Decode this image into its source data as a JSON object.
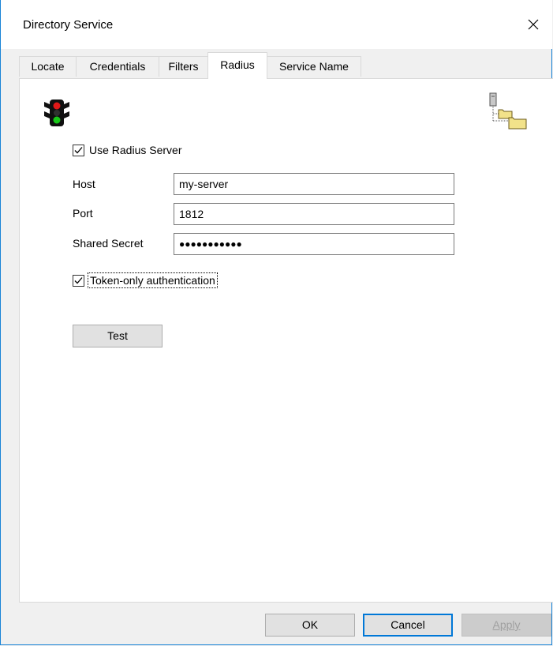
{
  "window": {
    "title": "Directory Service"
  },
  "tabs": [
    {
      "label": "Locate"
    },
    {
      "label": "Credentials"
    },
    {
      "label": "Filters"
    },
    {
      "label": "Radius",
      "active": true
    },
    {
      "label": "Service Name"
    }
  ],
  "radius": {
    "use_radius": {
      "label": "Use Radius Server",
      "checked": true
    },
    "host": {
      "label": "Host",
      "value": "my-server"
    },
    "port": {
      "label": "Port",
      "value": "1812"
    },
    "secret": {
      "label": "Shared Secret",
      "value": "●●●●●●●●●●●"
    },
    "token_only": {
      "label": "Token-only authentication",
      "checked": true
    },
    "test_label": "Test"
  },
  "footer": {
    "ok_label": "OK",
    "cancel_label": "Cancel",
    "apply_label": "Apply"
  },
  "icons": {
    "status": "traffic-light-icon",
    "directory": "directory-tree-icon"
  }
}
